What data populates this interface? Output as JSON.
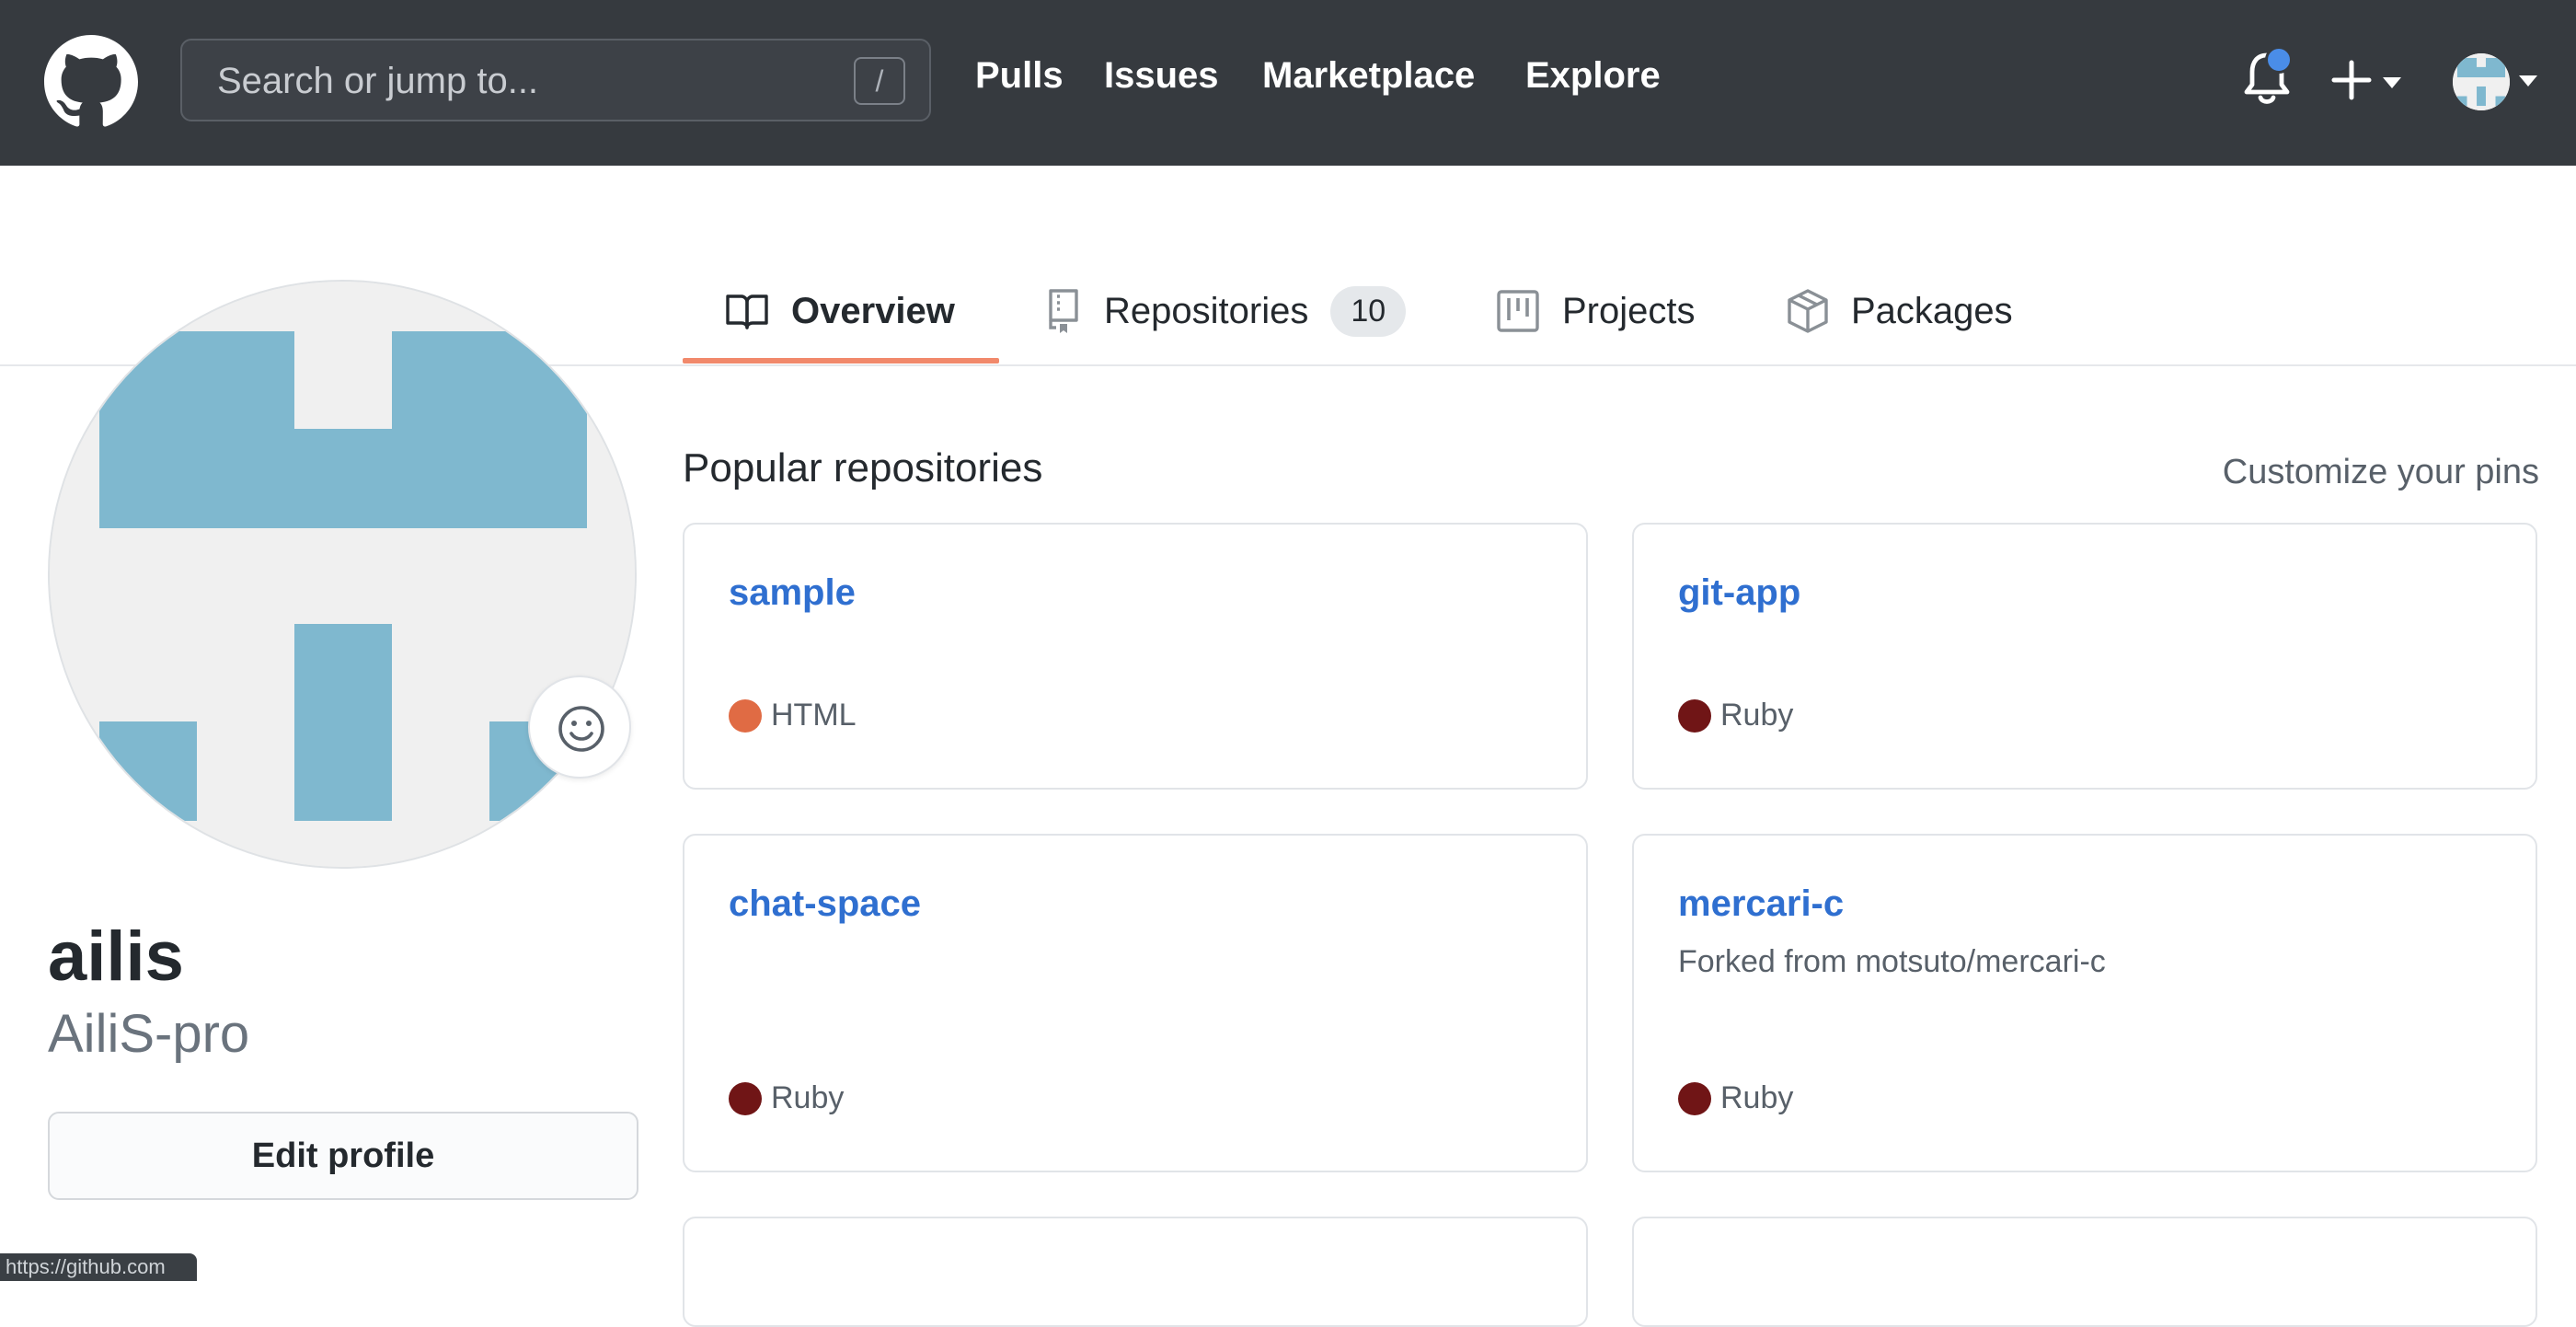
{
  "header": {
    "search_placeholder": "Search or jump to...",
    "search_shortcut": "/",
    "nav": [
      "Pulls",
      "Issues",
      "Marketplace",
      "Explore"
    ]
  },
  "tabs": [
    {
      "label": "Overview",
      "icon": "book-icon",
      "active": true
    },
    {
      "label": "Repositories",
      "icon": "repo-icon",
      "count": "10"
    },
    {
      "label": "Projects",
      "icon": "project-icon"
    },
    {
      "label": "Packages",
      "icon": "package-icon"
    }
  ],
  "profile": {
    "name": "ailis",
    "login": "AiliS-pro",
    "edit_label": "Edit profile"
  },
  "pinned": {
    "title": "Popular repositories",
    "customize_label": "Customize your pins",
    "repos": [
      {
        "name": "sample",
        "description": "",
        "language": "HTML",
        "language_color": "#e06b44"
      },
      {
        "name": "git-app",
        "description": "",
        "language": "Ruby",
        "language_color": "#701516"
      },
      {
        "name": "chat-space",
        "description": "",
        "language": "Ruby",
        "language_color": "#701516"
      },
      {
        "name": "mercari-c",
        "description": "Forked from motsuto/mercari-c",
        "language": "Ruby",
        "language_color": "#701516"
      }
    ]
  },
  "status_bar": {
    "url": "https://github.com"
  },
  "colors": {
    "header_bg": "#363a3f",
    "link": "#2f6fd0",
    "tab_underline": "#f1896b",
    "avatar_blue": "#7fb8cf",
    "notification_dot": "#4a8de8"
  }
}
